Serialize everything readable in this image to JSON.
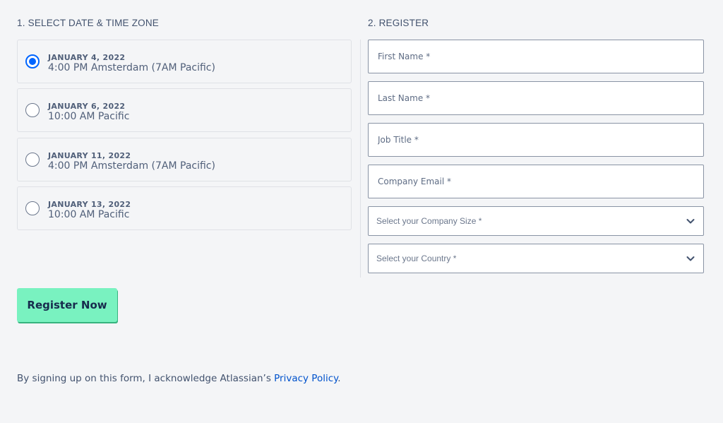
{
  "left_section": {
    "title": "1. SELECT DATE & TIME ZONE",
    "options": [
      {
        "date": "JANUARY 4, 2022",
        "time": "4:00 PM Amsterdam (7AM Pacific)",
        "selected": true
      },
      {
        "date": "JANUARY 6, 2022",
        "time": "10:00 AM Pacific",
        "selected": false
      },
      {
        "date": "JANUARY 11, 2022",
        "time": "4:00 PM Amsterdam (7AM Pacific)",
        "selected": false
      },
      {
        "date": "JANUARY 13, 2022",
        "time": "10:00 AM Pacific",
        "selected": false
      }
    ]
  },
  "right_section": {
    "title": "2. REGISTER",
    "fields": {
      "first_name": {
        "placeholder": "First Name *",
        "value": ""
      },
      "last_name": {
        "placeholder": "Last Name *",
        "value": ""
      },
      "job_title": {
        "placeholder": "Job Title *",
        "value": ""
      },
      "company_email": {
        "placeholder": "Company Email *",
        "value": ""
      }
    },
    "selects": {
      "company_size": {
        "label": "Select your Company Size *"
      },
      "country": {
        "label": "Select your Country *"
      }
    }
  },
  "register_button": {
    "label": "Register Now"
  },
  "footer": {
    "text": "By signing up on this form, I acknowledge Atlassian’s ",
    "link_text": "Privacy Policy",
    "suffix": "."
  },
  "colors": {
    "background": "#f4f5f7",
    "radio_selected": "#0065ff",
    "button": "#79f2c0",
    "link": "#0052cc"
  }
}
